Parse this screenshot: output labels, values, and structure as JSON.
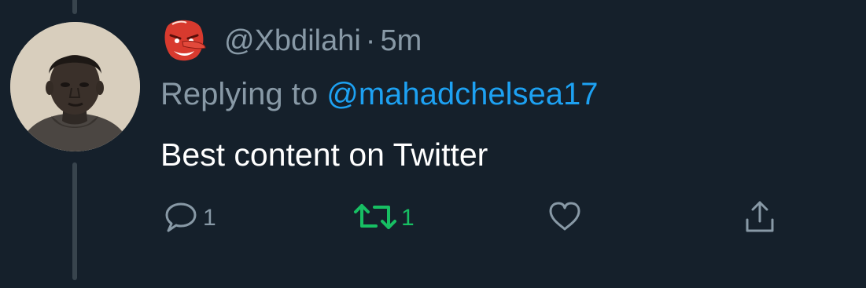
{
  "tweet": {
    "handle": "@Xbdilahi",
    "separator": "·",
    "time": "5m",
    "replying_prefix": "Replying to ",
    "replying_to": "@mahadchelsea17",
    "text": "Best content on Twitter",
    "emoji_icon": "tengu-mask-emoji"
  },
  "actions": {
    "reply_count": "1",
    "retweet_count": "1",
    "like_count": "",
    "retweet_active": true
  },
  "colors": {
    "background": "#15202b",
    "secondary_text": "#8899a6",
    "link": "#1da1f2",
    "retweet": "#17bf63",
    "thread_line": "#38444d"
  }
}
